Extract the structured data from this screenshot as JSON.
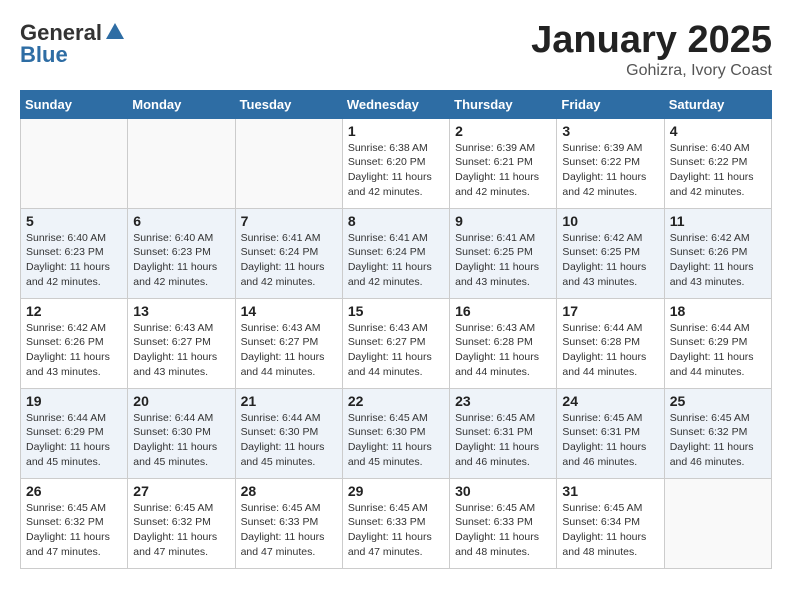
{
  "header": {
    "logo_general": "General",
    "logo_blue": "Blue",
    "month_title": "January 2025",
    "subtitle": "Gohizra, Ivory Coast"
  },
  "weekdays": [
    "Sunday",
    "Monday",
    "Tuesday",
    "Wednesday",
    "Thursday",
    "Friday",
    "Saturday"
  ],
  "weeks": [
    [
      {
        "day": null
      },
      {
        "day": null
      },
      {
        "day": null
      },
      {
        "day": "1",
        "sunrise": "6:38 AM",
        "sunset": "6:20 PM",
        "daylight": "11 hours and 42 minutes."
      },
      {
        "day": "2",
        "sunrise": "6:39 AM",
        "sunset": "6:21 PM",
        "daylight": "11 hours and 42 minutes."
      },
      {
        "day": "3",
        "sunrise": "6:39 AM",
        "sunset": "6:22 PM",
        "daylight": "11 hours and 42 minutes."
      },
      {
        "day": "4",
        "sunrise": "6:40 AM",
        "sunset": "6:22 PM",
        "daylight": "11 hours and 42 minutes."
      }
    ],
    [
      {
        "day": "5",
        "sunrise": "6:40 AM",
        "sunset": "6:23 PM",
        "daylight": "11 hours and 42 minutes."
      },
      {
        "day": "6",
        "sunrise": "6:40 AM",
        "sunset": "6:23 PM",
        "daylight": "11 hours and 42 minutes."
      },
      {
        "day": "7",
        "sunrise": "6:41 AM",
        "sunset": "6:24 PM",
        "daylight": "11 hours and 42 minutes."
      },
      {
        "day": "8",
        "sunrise": "6:41 AM",
        "sunset": "6:24 PM",
        "daylight": "11 hours and 42 minutes."
      },
      {
        "day": "9",
        "sunrise": "6:41 AM",
        "sunset": "6:25 PM",
        "daylight": "11 hours and 43 minutes."
      },
      {
        "day": "10",
        "sunrise": "6:42 AM",
        "sunset": "6:25 PM",
        "daylight": "11 hours and 43 minutes."
      },
      {
        "day": "11",
        "sunrise": "6:42 AM",
        "sunset": "6:26 PM",
        "daylight": "11 hours and 43 minutes."
      }
    ],
    [
      {
        "day": "12",
        "sunrise": "6:42 AM",
        "sunset": "6:26 PM",
        "daylight": "11 hours and 43 minutes."
      },
      {
        "day": "13",
        "sunrise": "6:43 AM",
        "sunset": "6:27 PM",
        "daylight": "11 hours and 43 minutes."
      },
      {
        "day": "14",
        "sunrise": "6:43 AM",
        "sunset": "6:27 PM",
        "daylight": "11 hours and 44 minutes."
      },
      {
        "day": "15",
        "sunrise": "6:43 AM",
        "sunset": "6:27 PM",
        "daylight": "11 hours and 44 minutes."
      },
      {
        "day": "16",
        "sunrise": "6:43 AM",
        "sunset": "6:28 PM",
        "daylight": "11 hours and 44 minutes."
      },
      {
        "day": "17",
        "sunrise": "6:44 AM",
        "sunset": "6:28 PM",
        "daylight": "11 hours and 44 minutes."
      },
      {
        "day": "18",
        "sunrise": "6:44 AM",
        "sunset": "6:29 PM",
        "daylight": "11 hours and 44 minutes."
      }
    ],
    [
      {
        "day": "19",
        "sunrise": "6:44 AM",
        "sunset": "6:29 PM",
        "daylight": "11 hours and 45 minutes."
      },
      {
        "day": "20",
        "sunrise": "6:44 AM",
        "sunset": "6:30 PM",
        "daylight": "11 hours and 45 minutes."
      },
      {
        "day": "21",
        "sunrise": "6:44 AM",
        "sunset": "6:30 PM",
        "daylight": "11 hours and 45 minutes."
      },
      {
        "day": "22",
        "sunrise": "6:45 AM",
        "sunset": "6:30 PM",
        "daylight": "11 hours and 45 minutes."
      },
      {
        "day": "23",
        "sunrise": "6:45 AM",
        "sunset": "6:31 PM",
        "daylight": "11 hours and 46 minutes."
      },
      {
        "day": "24",
        "sunrise": "6:45 AM",
        "sunset": "6:31 PM",
        "daylight": "11 hours and 46 minutes."
      },
      {
        "day": "25",
        "sunrise": "6:45 AM",
        "sunset": "6:32 PM",
        "daylight": "11 hours and 46 minutes."
      }
    ],
    [
      {
        "day": "26",
        "sunrise": "6:45 AM",
        "sunset": "6:32 PM",
        "daylight": "11 hours and 47 minutes."
      },
      {
        "day": "27",
        "sunrise": "6:45 AM",
        "sunset": "6:32 PM",
        "daylight": "11 hours and 47 minutes."
      },
      {
        "day": "28",
        "sunrise": "6:45 AM",
        "sunset": "6:33 PM",
        "daylight": "11 hours and 47 minutes."
      },
      {
        "day": "29",
        "sunrise": "6:45 AM",
        "sunset": "6:33 PM",
        "daylight": "11 hours and 47 minutes."
      },
      {
        "day": "30",
        "sunrise": "6:45 AM",
        "sunset": "6:33 PM",
        "daylight": "11 hours and 48 minutes."
      },
      {
        "day": "31",
        "sunrise": "6:45 AM",
        "sunset": "6:34 PM",
        "daylight": "11 hours and 48 minutes."
      },
      {
        "day": null
      }
    ]
  ]
}
